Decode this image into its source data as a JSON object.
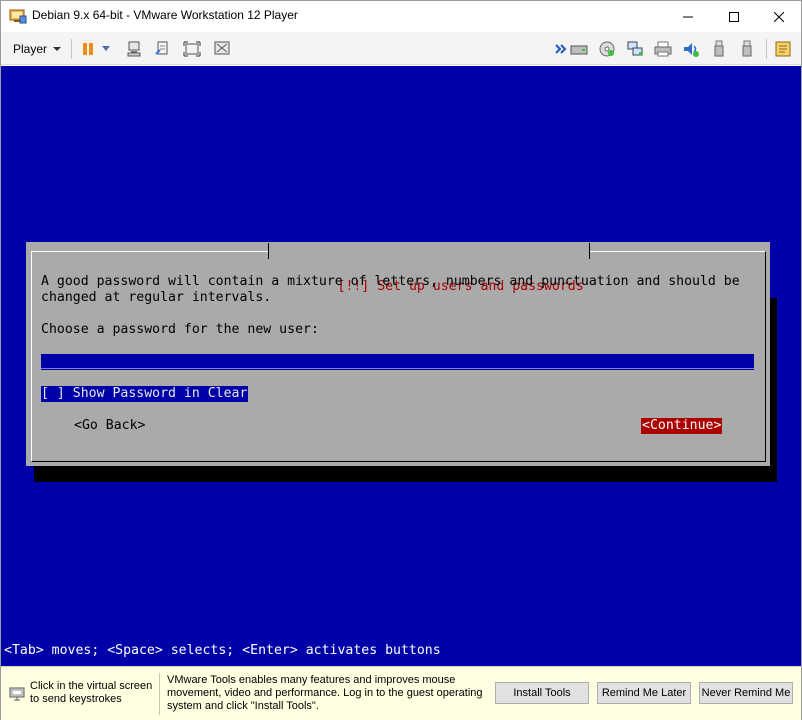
{
  "window": {
    "title": "Debian 9.x 64-bit - VMware Workstation 12 Player",
    "controls": [
      "minimize-icon",
      "maximize-icon",
      "close-icon"
    ]
  },
  "toolbar": {
    "player_label": "Player",
    "icons": [
      "pause-icon",
      "dropdown-arrow-icon",
      "send-ctrl-alt-del-icon",
      "fit-guest-icon",
      "full-screen-icon",
      "unity-icon",
      "forward-arrows-icon",
      "hard-disk-icon",
      "cd-dvd-icon",
      "network-adapter-icon",
      "printer-icon",
      "sound-icon",
      "usb-device-icon",
      "usb-device-icon",
      "message-log-icon"
    ]
  },
  "installer": {
    "dialog_title": "[!!] Set up users and passwords",
    "description_line1": "A good password will contain a mixture of letters, numbers and punctuation and should be",
    "description_line2": "changed at regular intervals.",
    "prompt": "Choose a password for the new user:",
    "password_value": "******",
    "show_password_label": "[ ] Show Password in Clear",
    "go_back_label": "<Go Back>",
    "continue_label": "<Continue>",
    "status_line": "<Tab> moves; <Space> selects; <Enter> activates buttons",
    "colors": {
      "background": "#0000a8",
      "dialog": "#aaaaaa",
      "title": "#aa0000",
      "focus_button": "#aa0000"
    }
  },
  "notification": {
    "hint_text": "Click in the virtual screen to send keystrokes",
    "message": "VMware Tools enables many features and improves mouse movement, video and performance. Log in to the guest operating system and click \"Install Tools\".",
    "install_label": "Install Tools",
    "remind_later_label": "Remind Me Later",
    "never_remind_label": "Never Remind Me"
  }
}
